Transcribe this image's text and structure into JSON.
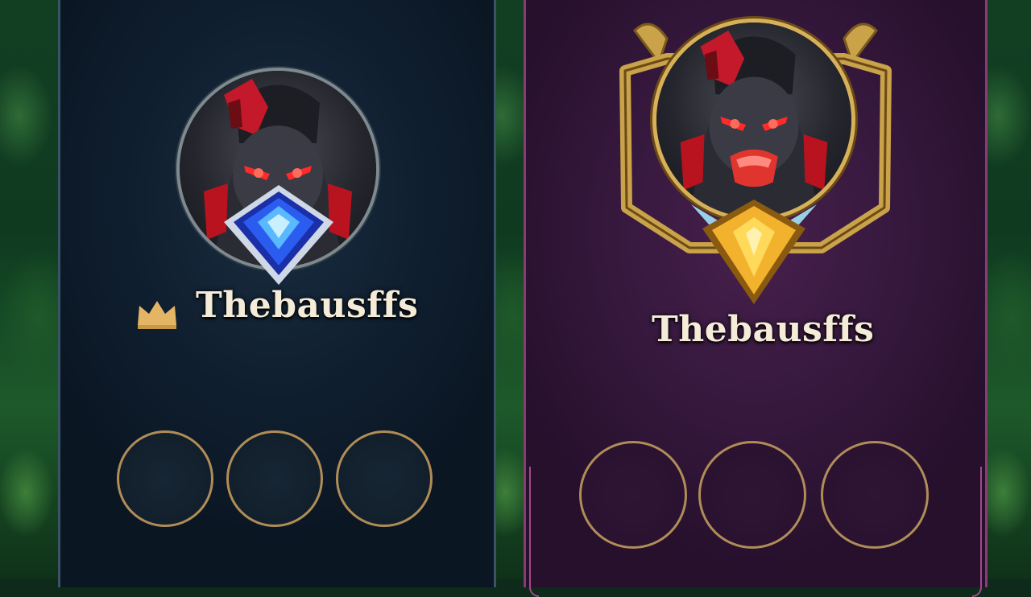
{
  "players": [
    {
      "panel": "blue",
      "name": "Thebausffs",
      "has_crown": true,
      "rank_emblem": "diamond-emblem-icon",
      "border_style": "plain-silver-ring",
      "badge_slots": 3
    },
    {
      "panel": "purple",
      "name": "Thebausffs",
      "has_crown": false,
      "rank_emblem": "gold-emblem-icon",
      "border_style": "gold-ornate-frame",
      "badge_slots": 3
    }
  ],
  "colors": {
    "blue_panel": "#0f1e2e",
    "purple_panel": "#34173b",
    "slot_ring": "#b08d57",
    "name_text": "#f4ecd8",
    "crown": "#e4b565",
    "diamond": "#2b5cf0",
    "gold": "#f2b22e"
  }
}
